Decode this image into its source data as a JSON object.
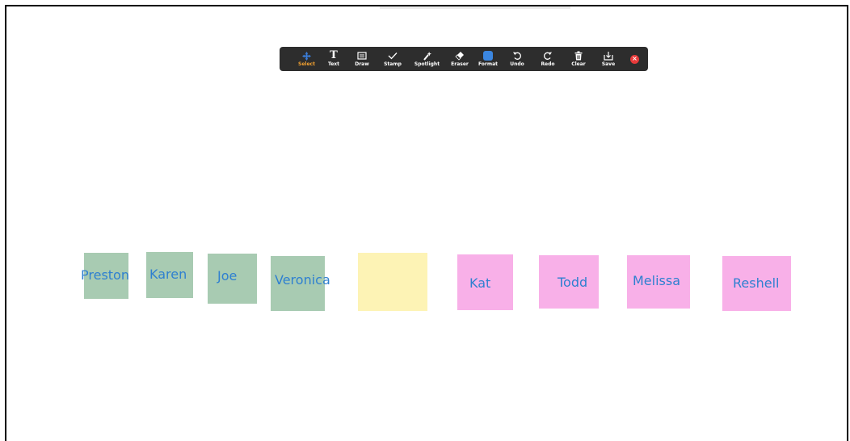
{
  "toolbar": {
    "tools": [
      {
        "label": "Select",
        "icon": "select-move-icon",
        "active": true
      },
      {
        "label": "Text",
        "icon": "text-icon"
      },
      {
        "label": "Draw",
        "icon": "draw-icon"
      },
      {
        "label": "Stamp",
        "icon": "stamp-check-icon"
      },
      {
        "label": "Spotlight",
        "icon": "spotlight-icon"
      },
      {
        "label": "Eraser",
        "icon": "eraser-icon"
      },
      {
        "label": "Format",
        "icon": "format-color-icon"
      },
      {
        "label": "Undo",
        "icon": "undo-icon"
      },
      {
        "label": "Redo",
        "icon": "redo-icon"
      },
      {
        "label": "Clear",
        "icon": "clear-trash-icon"
      },
      {
        "label": "Save",
        "icon": "save-icon"
      }
    ],
    "close_icon": "close-icon",
    "colors": {
      "background": "#2d2d2d",
      "active_label": "#f0a031",
      "select_icon": "#3b7dd8",
      "format_swatch": "#3b86e0",
      "close": "#e83a3a"
    }
  },
  "notes": [
    {
      "text": "Preston",
      "color": "#a8cbb2"
    },
    {
      "text": "Karen",
      "color": "#a8cbb2"
    },
    {
      "text": "Joe",
      "color": "#a8cbb2"
    },
    {
      "text": "Veronica",
      "color": "#a8cbb2"
    },
    {
      "text": "",
      "color": "#fdf3b5"
    },
    {
      "text": "Kat",
      "color": "#f8b0e8"
    },
    {
      "text": "Todd",
      "color": "#f8b0e8"
    },
    {
      "text": "Melissa",
      "color": "#f8b0e8"
    },
    {
      "text": "Reshell",
      "color": "#f8b0e8"
    }
  ],
  "note_text_color": "#2f80d0"
}
